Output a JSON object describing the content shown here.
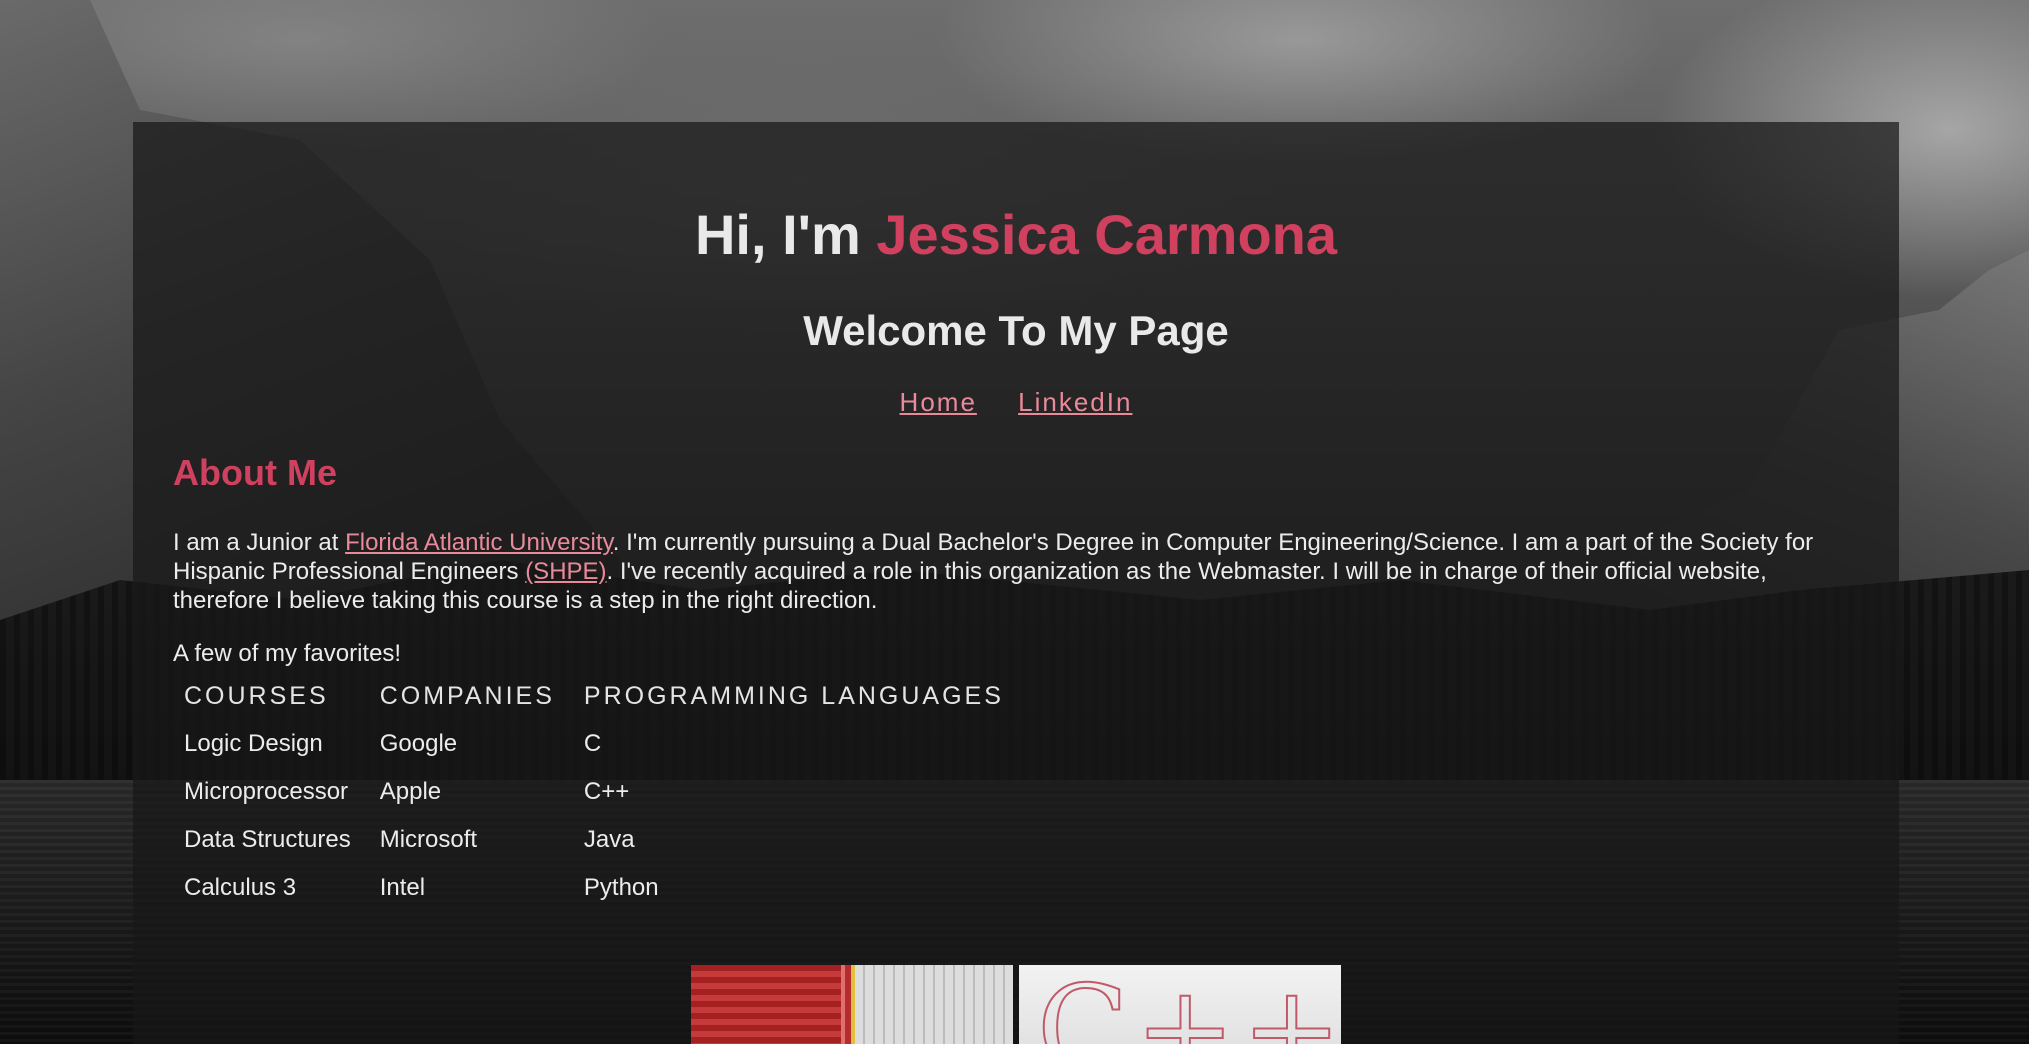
{
  "hero": {
    "greeting": "Hi, I'm ",
    "name": "Jessica Carmona",
    "subtitle": "Welcome To My Page"
  },
  "nav": {
    "items": [
      {
        "label": "Home"
      },
      {
        "label": "LinkedIn"
      }
    ]
  },
  "about": {
    "heading": "About Me",
    "text_part1": "I am a Junior at ",
    "link_fau": "Florida Atlantic University",
    "text_part2": ". I'm currently pursuing a Dual Bachelor's Degree in Computer Engineering/Science. I am a part of the Society for Hispanic Professional Engineers ",
    "link_shpe": "(SHPE)",
    "text_part3": ". I've recently acquired a role in this organization as the Webmaster. I will be in charge of their official website, therefore I believe taking this course is a step in the right direction."
  },
  "favorites": {
    "label": "A few of my favorites!",
    "headers": [
      "COURSES",
      "COMPANIES",
      "PROGRAMMING LANGUAGES"
    ],
    "rows": [
      [
        "Logic Design",
        "Google",
        "C"
      ],
      [
        "Microprocessor",
        "Apple",
        "C++"
      ],
      [
        "Data Structures",
        "Microsoft",
        "Java"
      ],
      [
        "Calculus 3",
        "Intel",
        "Python"
      ]
    ]
  },
  "colors": {
    "accent": "#d0405f",
    "link": "#e98a9b",
    "panel": "rgba(24,24,24,0.72)"
  }
}
